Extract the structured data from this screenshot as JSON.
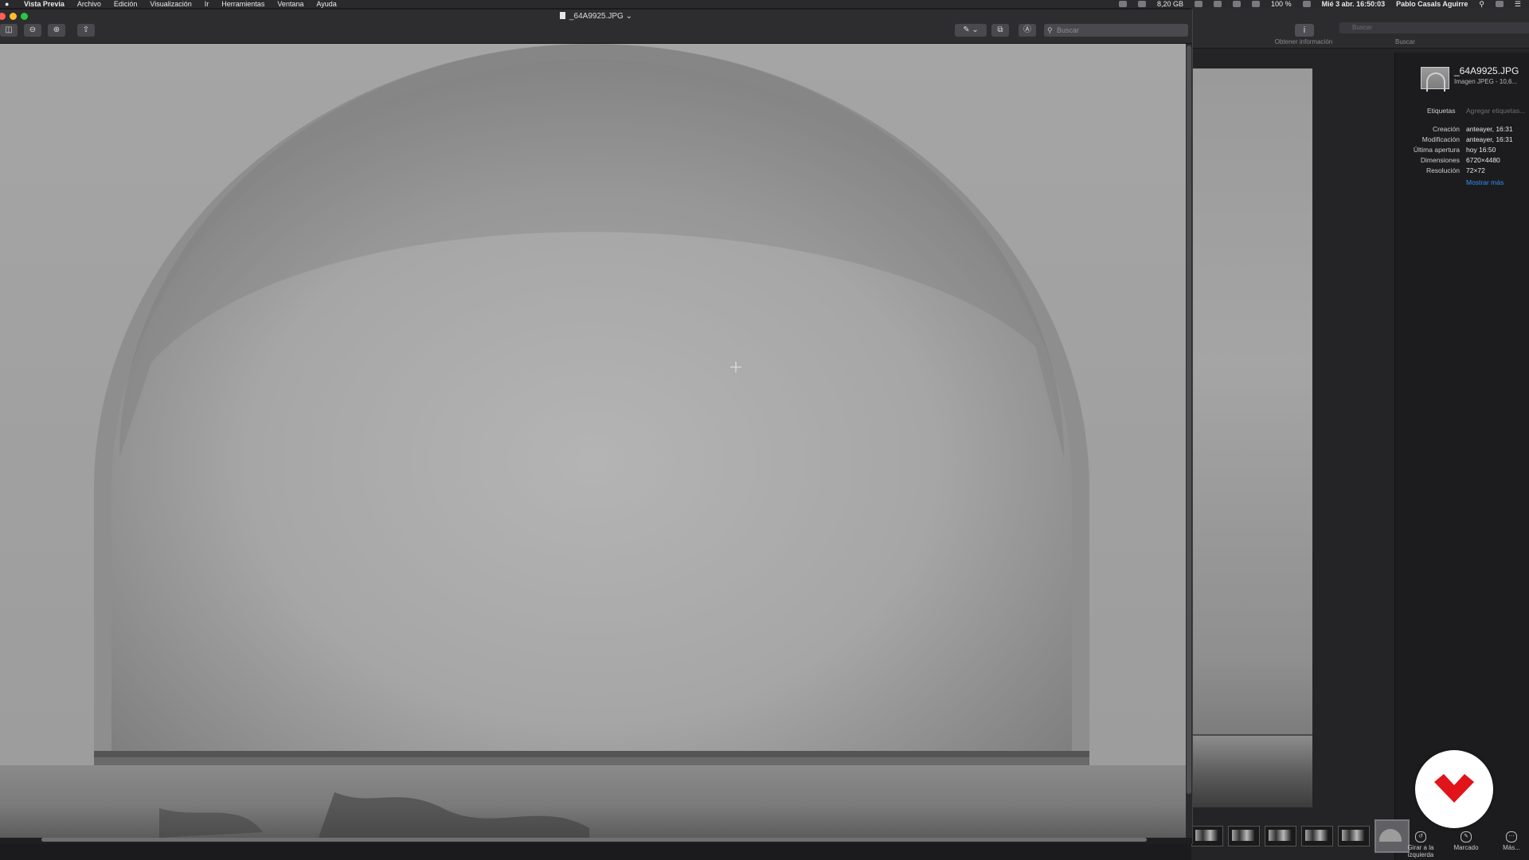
{
  "menubar": {
    "app_name": "Vista Previa",
    "menus": [
      "Archivo",
      "Edición",
      "Visualización",
      "Ir",
      "Herramientas",
      "Ventana",
      "Ayuda"
    ],
    "storage": "8,20 GB",
    "battery": "100 %",
    "clock": "Mié 3 abr.  16:50:03",
    "user": "Pablo Casals Aguirre"
  },
  "window": {
    "title": "_64A9925.JPG",
    "search_placeholder": "Buscar"
  },
  "background_window": {
    "info_label": "Obtener información",
    "search_placeholder": "Buscar",
    "search_label": "Buscar"
  },
  "inspector": {
    "filename": "_64A9925.JPG",
    "kind": "Imagen JPEG - 10,6...",
    "tags_key": "Etiquetas",
    "tags_add": "Agregar etiquetas...",
    "rows": [
      {
        "key": "Creación",
        "value": "anteayer, 16:31"
      },
      {
        "key": "Modificación",
        "value": "anteayer, 16:31"
      },
      {
        "key": "Última apertura",
        "value": "hoy 16:50"
      },
      {
        "key": "Dimensiones",
        "value": "6720×4480"
      },
      {
        "key": "Resolución",
        "value": "72×72"
      }
    ],
    "show_more": "Mostrar más"
  },
  "actions": [
    {
      "label": "Girar a la izquierda",
      "icon": "rotate-left-icon"
    },
    {
      "label": "Marcado",
      "icon": "markup-icon"
    },
    {
      "label": "Más...",
      "icon": "more-icon"
    }
  ],
  "colors": {
    "brand_red": "#e11419",
    "link_blue": "#2f8ff7"
  }
}
